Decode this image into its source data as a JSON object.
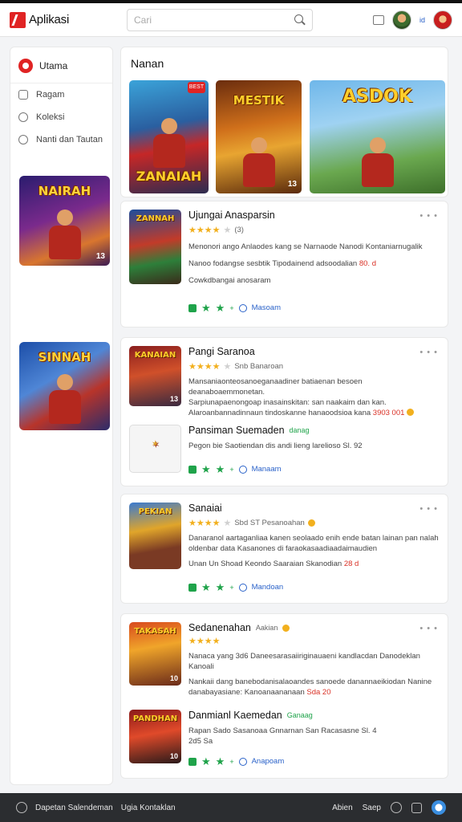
{
  "app": {
    "title": "Aplikasi"
  },
  "header": {
    "search_placeholder": "Cari",
    "user_label": "id"
  },
  "sidebar": {
    "head": "Utama",
    "items": [
      {
        "label": "Ragam",
        "icon": "tag-icon"
      },
      {
        "label": "Koleksi",
        "icon": "search-circle-icon"
      },
      {
        "label": "Nanti dan Tautan",
        "icon": "clock-icon"
      }
    ],
    "games": [
      {
        "title": "NAIRAH",
        "num": "13"
      },
      {
        "title": "SINNAH",
        "num": ""
      }
    ]
  },
  "featured": {
    "title": "Nanan",
    "cards": [
      {
        "title": "ZANAIAH",
        "badge": "BEST"
      },
      {
        "title": "MESTIK",
        "num": "13"
      },
      {
        "title": "ASDOK"
      }
    ]
  },
  "cards": [
    {
      "title": "Ujungai Anasparsin",
      "thumb": "ZANNAH",
      "rating": "(3)",
      "desc": "Menonori ango Anlaodes kang se Narnaode Nanodi Kontaniarnugalik",
      "desc2": "Nanoo fodangse sesbtik Tipodainend adsoodalian",
      "price": "80. d",
      "meta": "Cowkdbangai anosaram",
      "link": "Masoam"
    },
    {
      "title": "Pangi Saranoa",
      "thumb": "KANAIAN",
      "num": "13",
      "rating": "Snb Banaroan",
      "desc": "Mansaniaonteosanoeganaadiner batiaenan besoen deanaboaemmonetan.",
      "desc2": "Sarpiunapaenongoap inasainskitan: san naakaim dan kan.",
      "desc3": "Alaroanbannadinnaun tindoskanne hanaoodsioa kana",
      "price": "3903 001",
      "sub_title": "Pansiman Suemaden",
      "sub_tag": "danag",
      "sub_desc": "Pegon bie Saotiendan dis andi lieng larelioso Sl. 92",
      "link": "Manaam"
    },
    {
      "title": "Sanaiai",
      "thumb": "PEKIAN",
      "rating": "Sbd ST Pesanoahan",
      "desc": "Danaranol aartaganliaa kanen seolaado enih ende batan lainan pan nalah",
      "desc2": "oldenbar data Kasanones di faraokasaadiaadaimaudien",
      "meta_pre": "Unan Un Shoad Keondo Saaraian Skanodian",
      "price": "28 d",
      "link": "Mandoan"
    },
    {
      "title": "Sedanenahan",
      "title_sub": "Aakian",
      "thumb": "TAKASAH",
      "num": "10",
      "desc": "Nanaca yang 3d6 Daneesarasaiiriginauaeni kandlacdan Danodeklan",
      "desc2": "Kanoali",
      "desc3": "Nankaii dang banebodanisalaoandes sanoede danannaeikiodan Nanine",
      "desc4": "danabayasiane: Kanoanaananaan",
      "price": "Sda 20",
      "sub_title": "Danmianl Kaemedan",
      "sub_tag": "Ganaag",
      "sub_desc": "Rapan Sado Sasanoaa Gnnarnan San Racasasne Sl. 4",
      "sub_price": "2d5 Sa",
      "sub_thumb": "PANDHAN",
      "sub_num": "10",
      "link": "Anapoam"
    }
  ],
  "bottombar": {
    "left": "Dapetan Salendeman",
    "left2": "Ugia Kontaklan",
    "right": "Abien",
    "right2": "Saep"
  }
}
